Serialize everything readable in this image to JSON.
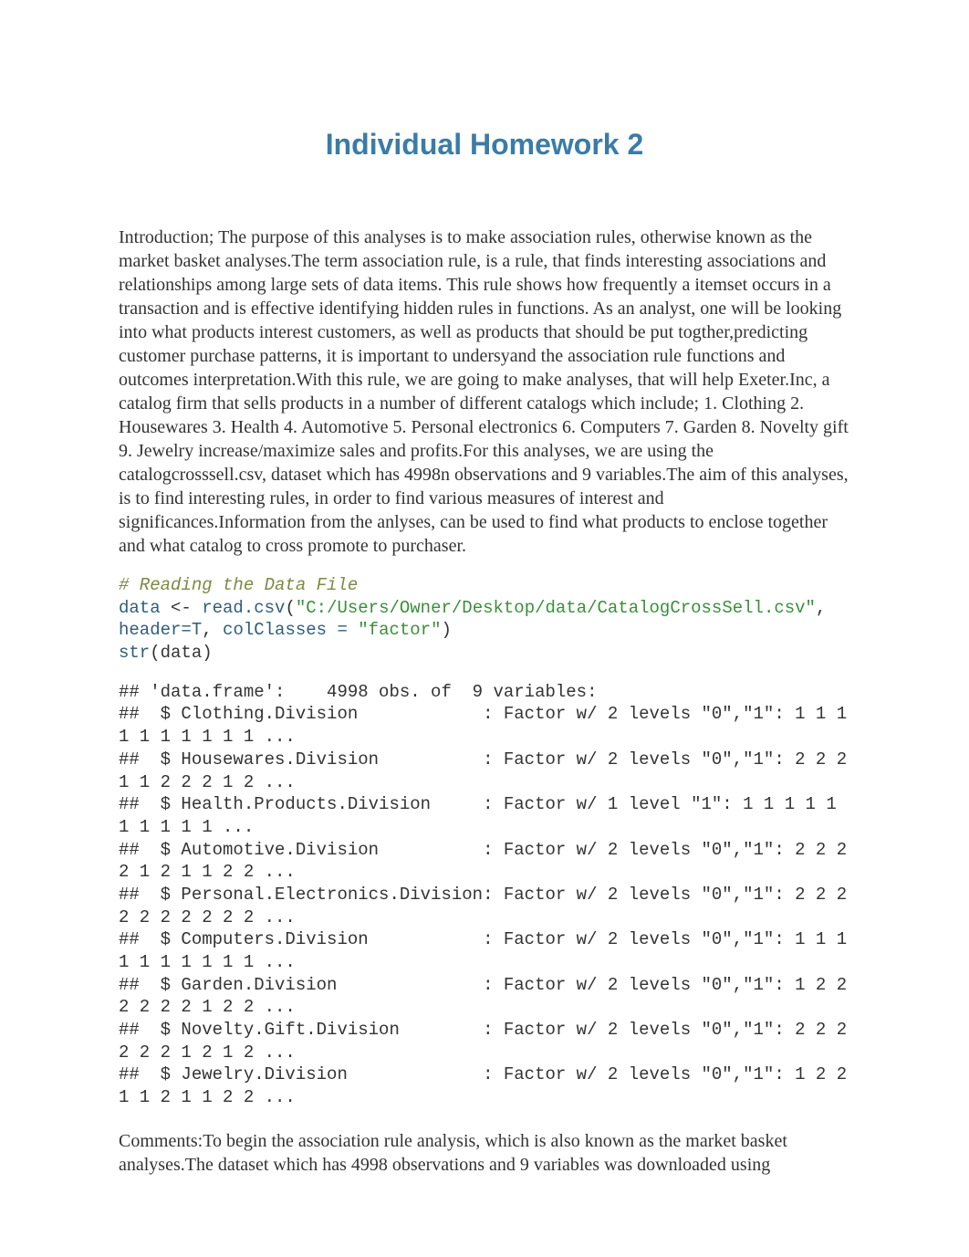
{
  "title": "Individual Homework 2",
  "intro": "Introduction; The purpose of this analyses is to make association rules, otherwise known as the market basket analyses.The term association rule, is a rule, that finds interesting associations and relationships among large sets of data items. This rule shows how frequently a itemset occurs in a transaction and is effective identifying hidden rules in functions. As an analyst, one will be looking into what products interest customers, as well as products that should be put togther,predicting customer purchase patterns, it is important to undersyand the association rule functions and outcomes interpretation.With this rule, we are going to make analyses, that will help Exeter.Inc, a catalog firm that sells products in a number of different catalogs which include; 1. Clothing 2. Housewares 3. Health 4. Automotive 5. Personal electronics 6. Computers 7. Garden 8. Novelty gift 9. Jewelry increase/maximize sales and profits.For this analyses, we are using the catalogcrosssell.csv, dataset which has 4998n observations and 9 variables.The aim of this analyses, is to find interesting rules, in order to find various measures of interest and significances.Information from the anlyses, can be used to find what products to enclose together and what catalog to cross promote to purchaser.",
  "code": {
    "comment": "# Reading the Data File",
    "line1_ident": "data ",
    "line1_assign": "<-",
    "line1_func": " read.csv",
    "line1_paren": "(",
    "line1_string": "\"C:/Users/Owner/Desktop/data/CatalogCrossSell.csv\"",
    "line1_comma": ", ",
    "line2_header": "header=",
    "line2_T": "T",
    "line2_sep": ", ",
    "line2_cc": "colClasses = ",
    "line2_ccv": "\"factor\"",
    "line2_close": ")",
    "line3_func": "str",
    "line3_paren": "(data)"
  },
  "output": "## 'data.frame':    4998 obs. of  9 variables:\n##  $ Clothing.Division            : Factor w/ 2 levels \"0\",\"1\": 1 1 1 1 1 1 1 1 1 1 ...\n##  $ Housewares.Division          : Factor w/ 2 levels \"0\",\"1\": 2 2 2 1 1 2 2 2 1 2 ...\n##  $ Health.Products.Division     : Factor w/ 1 level \"1\": 1 1 1 1 1 1 1 1 1 1 ...\n##  $ Automotive.Division          : Factor w/ 2 levels \"0\",\"1\": 2 2 2 2 1 2 1 1 2 2 ...\n##  $ Personal.Electronics.Division: Factor w/ 2 levels \"0\",\"1\": 2 2 2 2 2 2 2 2 2 2 ...\n##  $ Computers.Division           : Factor w/ 2 levels \"0\",\"1\": 1 1 1 1 1 1 1 1 1 1 ...\n##  $ Garden.Division              : Factor w/ 2 levels \"0\",\"1\": 1 2 2 2 2 2 2 1 2 2 ...\n##  $ Novelty.Gift.Division        : Factor w/ 2 levels \"0\",\"1\": 2 2 2 2 2 2 1 2 1 2 ...\n##  $ Jewelry.Division             : Factor w/ 2 levels \"0\",\"1\": 1 2 2 1 1 2 1 1 2 2 ...",
  "comments": "Comments:To begin the association rule analysis, which is also known as the market basket analyses.The dataset which has 4998 observations and 9 variables was downloaded using"
}
